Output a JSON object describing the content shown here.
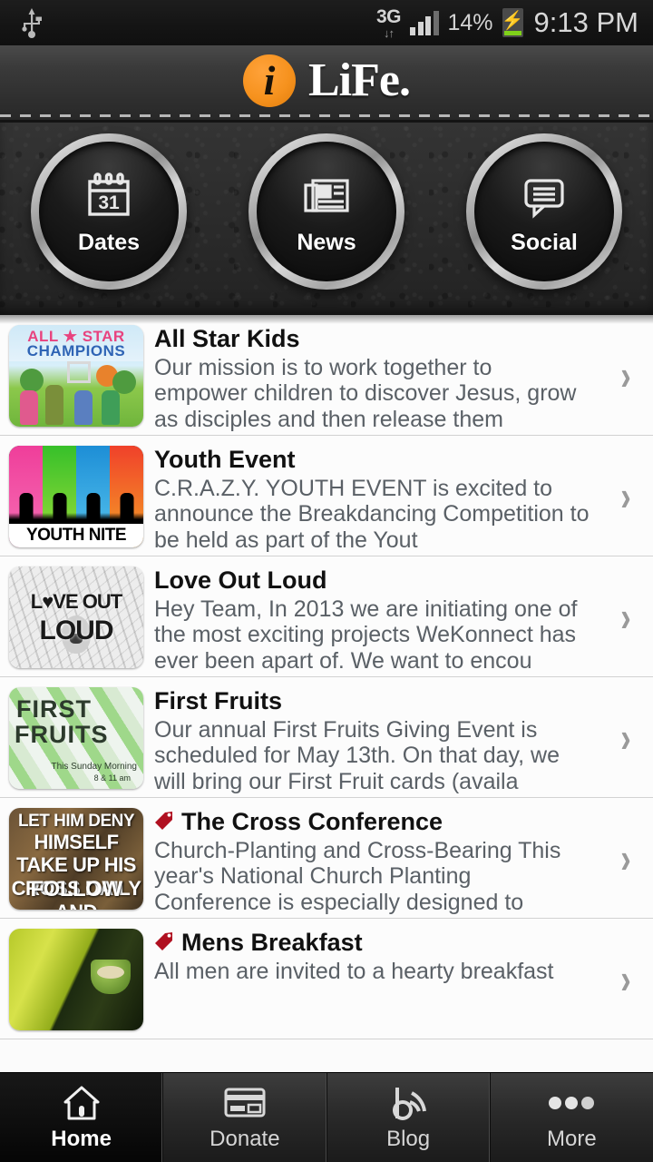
{
  "statusbar": {
    "usb_icon": "usb-icon",
    "network_type": "3G",
    "network_arrows": "↓↑",
    "signal_bars_filled": 3,
    "signal_bars_total": 4,
    "battery_percent": "14%",
    "battery_charging": true,
    "clock": "9:13 PM"
  },
  "header": {
    "logo_icon": "life-leaf-logo",
    "title": "LiFe."
  },
  "quick_buttons": [
    {
      "label": "Dates",
      "icon": "calendar-icon",
      "day": "31"
    },
    {
      "label": "News",
      "icon": "newspaper-icon"
    },
    {
      "label": "Social",
      "icon": "speech-bubble-icon"
    }
  ],
  "list": [
    {
      "title": "All Star Kids",
      "description": "Our mission is to work together to empower children to discover Jesus, grow as disciples and then release them",
      "thumb": "all-star-champions",
      "thumb_text": {
        "line1": "ALL ★ STAR",
        "line2": "CHAMPIONS"
      },
      "tagged": false,
      "chevron": "›"
    },
    {
      "title": "Youth Event",
      "description": "C.R.A.Z.Y. YOUTH EVENT is excited to announce the Breakdancing Competition to be held as part of the Yout",
      "thumb": "youth-nite",
      "thumb_text": {
        "line1": "YOUTH NITE"
      },
      "tagged": false,
      "chevron": "›"
    },
    {
      "title": "Love Out Loud",
      "description": "Hey Team, In 2013 we are initiating one of the most exciting projects WeKonnect has ever been apart of. We want to encou",
      "thumb": "love-out-loud",
      "thumb_text": {
        "line1": "L♥VE OUT",
        "line2": "LOUD"
      },
      "tagged": false,
      "chevron": "›"
    },
    {
      "title": "First Fruits",
      "description": "Our annual First Fruits Giving Event is scheduled for May 13th. On that day, we will bring our First Fruit cards (availa",
      "thumb": "first-fruits",
      "thumb_text": {
        "line1": "FIRST",
        "line2": "FRUITS",
        "line3": "This Sunday Morning",
        "line4": "8 & 11 am"
      },
      "tagged": false,
      "chevron": "›"
    },
    {
      "title": "The Cross Conference",
      "description": "Church-Planting and Cross-Bearing This year's National Church Planting Conference is especially designed to",
      "thumb": "cross-conference",
      "thumb_text": {
        "line1": "LET HIM DENY",
        "line2": "HIMSELF",
        "line3": "TAKE UP HIS CROSS DAILY AND",
        "line4": "FOLLOW"
      },
      "tagged": true,
      "chevron": "›"
    },
    {
      "title": "Mens Breakfast",
      "description": "All men are invited to a hearty breakfast",
      "thumb": "mens-breakfast",
      "thumb_text": {},
      "tagged": true,
      "chevron": "›"
    }
  ],
  "tabbar": [
    {
      "label": "Home",
      "icon": "home-icon",
      "active": true
    },
    {
      "label": "Donate",
      "icon": "credit-card-icon",
      "active": false
    },
    {
      "label": "Blog",
      "icon": "rss-blog-icon",
      "active": false
    },
    {
      "label": "More",
      "icon": "ellipsis-icon",
      "active": false
    }
  ],
  "colors": {
    "accent_orange": "#f6921e",
    "tag_red": "#b01020",
    "battery_green": "#7fd11a",
    "panel_dark": "#2b2b2b"
  }
}
